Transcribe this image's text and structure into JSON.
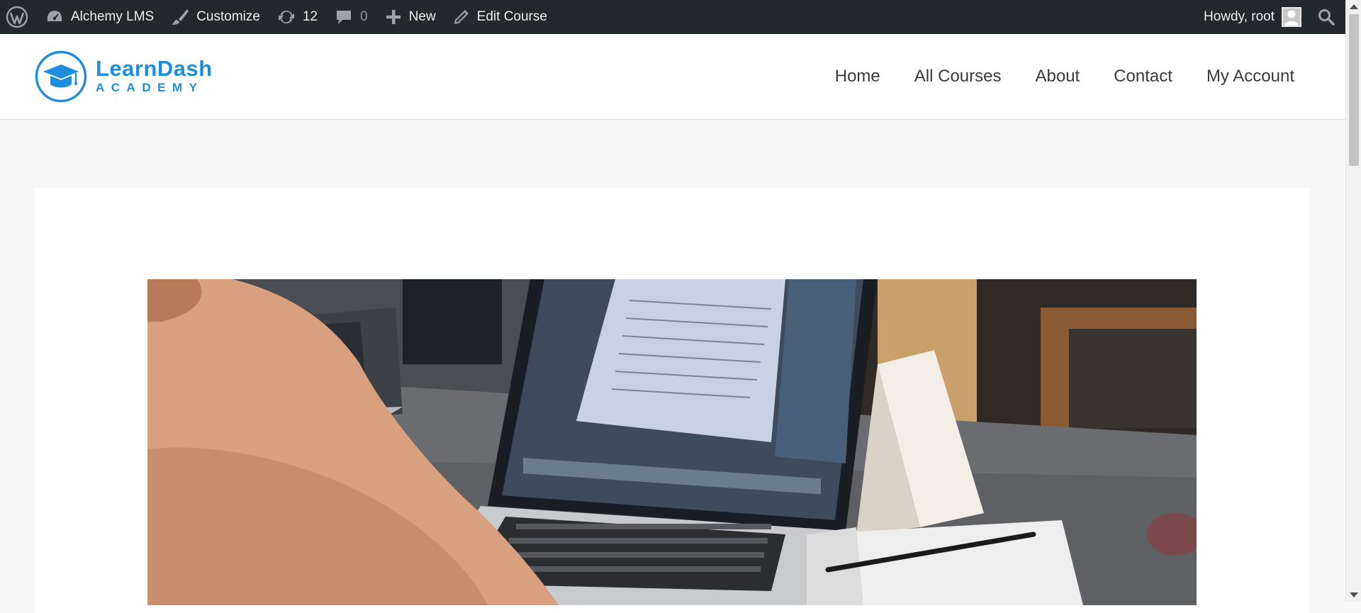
{
  "adminbar": {
    "site_name": "Alchemy LMS",
    "customize_label": "Customize",
    "updates_count": "12",
    "comments_count": "0",
    "new_label": "New",
    "edit_label": "Edit Course",
    "greeting": "Howdy, root",
    "icons": [
      "wordpress-logo",
      "dashboard",
      "paintbrush",
      "updates",
      "comment",
      "plus",
      "pencil",
      "avatar",
      "search"
    ]
  },
  "logo": {
    "line1": "LearnDash",
    "line2": "ACADEMY",
    "color": "#1e8ddd"
  },
  "nav": {
    "items": [
      "Home",
      "All Courses",
      "About",
      "Contact",
      "My Account"
    ]
  },
  "colors": {
    "adminbar_bg": "#23282d",
    "page_bg": "#f8f8f8",
    "accent": "#1e8ddd"
  }
}
